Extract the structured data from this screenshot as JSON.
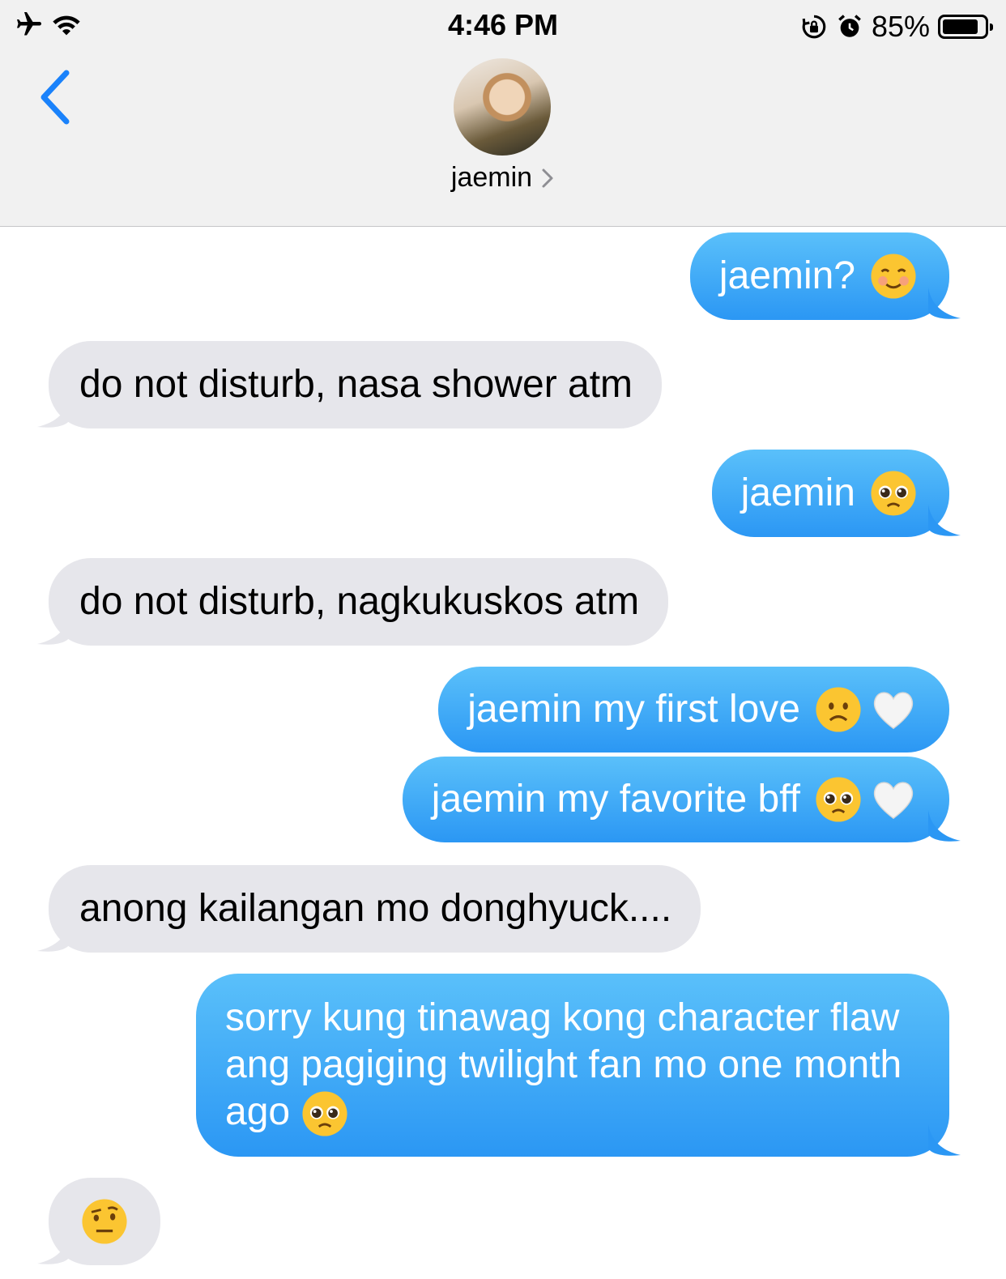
{
  "status_bar": {
    "time": "4:46 PM",
    "battery_percent": "85%",
    "battery_level": 0.85,
    "icons": [
      "airplane-icon",
      "wifi-icon",
      "orientation-lock-icon",
      "alarm-icon",
      "battery-icon"
    ]
  },
  "header": {
    "contact_name": "jaemin",
    "back_icon": "chevron-left-icon",
    "details_icon": "chevron-right-icon"
  },
  "colors": {
    "outgoing_top": "#5ac0fa",
    "outgoing_bottom": "#2b97f4",
    "incoming": "#e6e6eb",
    "accent": "#1a82fb",
    "header_bg": "#f1f1f1"
  },
  "messages": [
    {
      "dir": "out",
      "text": "jaemin?",
      "emojis": [
        "smiling-blush-emoji"
      ]
    },
    {
      "dir": "in",
      "text": "do not disturb, nasa shower atm",
      "emojis": []
    },
    {
      "dir": "out",
      "text": "jaemin",
      "emojis": [
        "pleading-face-emoji"
      ]
    },
    {
      "dir": "in",
      "text": "do not disturb, nagkukuskos atm",
      "emojis": []
    },
    {
      "dir": "out",
      "text": "jaemin my first love",
      "emojis": [
        "frowning-face-emoji",
        "white-heart-emoji"
      ]
    },
    {
      "dir": "out",
      "text": "jaemin my favorite bff",
      "emojis": [
        "pleading-face-emoji",
        "white-heart-emoji"
      ]
    },
    {
      "dir": "in",
      "text": "anong kailangan mo donghyuck....",
      "emojis": []
    },
    {
      "dir": "out",
      "text": "sorry kung tinawag kong character flaw ang pagiging twilight fan mo one month ago",
      "emojis": [
        "pleading-face-emoji"
      ]
    },
    {
      "dir": "in",
      "text": "",
      "emojis": [
        "raised-eyebrow-emoji"
      ]
    }
  ]
}
